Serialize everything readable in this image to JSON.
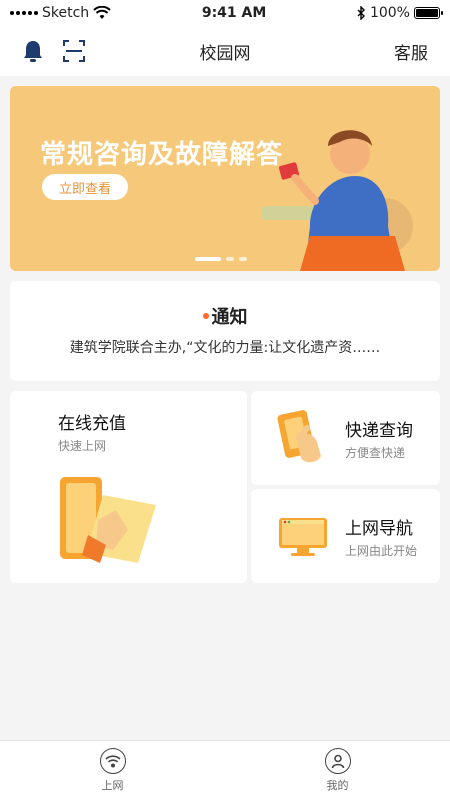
{
  "status_bar": {
    "carrier": "Sketch",
    "time": "9:41 AM",
    "battery": "100%",
    "battery_level": 1.0
  },
  "header": {
    "title": "校园网",
    "right_label": "客服"
  },
  "banner": {
    "title": "常规咨询及故障解答",
    "button_label": "立即查看",
    "slide_count": 3,
    "active_slide": 0
  },
  "notice": {
    "title": "通知",
    "text": "建筑学院联合主办,“文化的力量:让文化遗产资……"
  },
  "services": {
    "recharge": {
      "title": "在线充值",
      "subtitle": "快速上网"
    },
    "express": {
      "title": "快递查询",
      "subtitle": "方便查快递"
    },
    "navigation": {
      "title": "上网导航",
      "subtitle": "上网由此开始"
    }
  },
  "tabbar": {
    "items": [
      {
        "label": "上网",
        "icon": "wifi-icon"
      },
      {
        "label": "我的",
        "icon": "user-icon"
      }
    ]
  }
}
